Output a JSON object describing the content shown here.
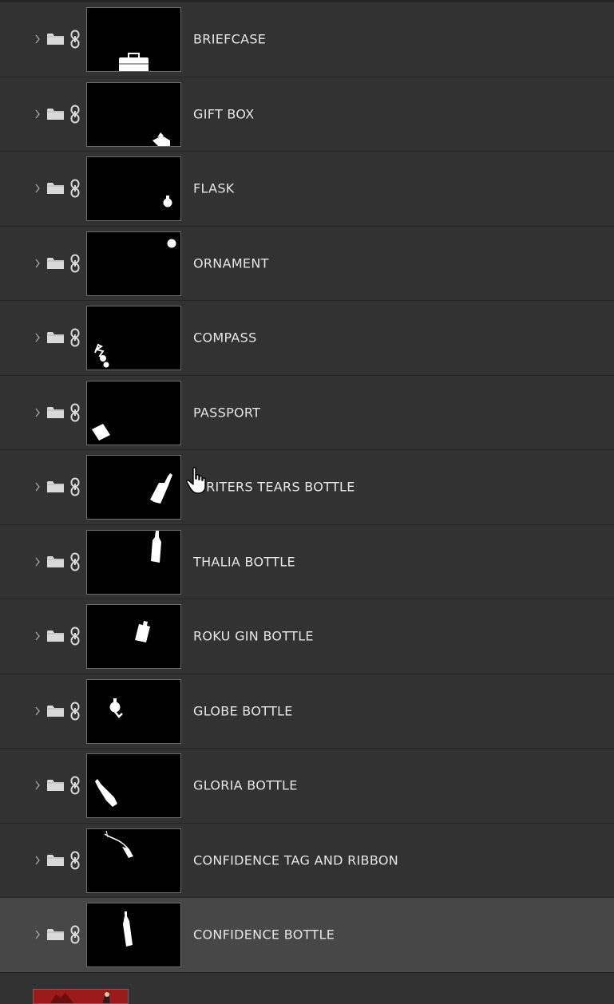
{
  "layers": [
    {
      "name": "BRIEFCASE",
      "mask": "briefcase",
      "selected": false
    },
    {
      "name": "GIFT BOX",
      "mask": "giftbox",
      "selected": false
    },
    {
      "name": "FLASK",
      "mask": "flask",
      "selected": false
    },
    {
      "name": "ORNAMENT",
      "mask": "ornament",
      "selected": false
    },
    {
      "name": "COMPASS",
      "mask": "compass",
      "selected": false
    },
    {
      "name": "PASSPORT",
      "mask": "passport",
      "selected": false
    },
    {
      "name": "WRITERS TEARS BOTTLE",
      "mask": "writers",
      "selected": false
    },
    {
      "name": "THALIA BOTTLE",
      "mask": "thalia",
      "selected": false
    },
    {
      "name": "ROKU GIN BOTTLE",
      "mask": "roku",
      "selected": false
    },
    {
      "name": "GLOBE BOTTLE",
      "mask": "globe",
      "selected": false
    },
    {
      "name": "GLORIA BOTTLE",
      "mask": "gloria",
      "selected": false
    },
    {
      "name": "CONFIDENCE TAG AND RIBBON",
      "mask": "tag",
      "selected": false
    },
    {
      "name": "CONFIDENCE BOTTLE",
      "mask": "confidence",
      "selected": true
    }
  ],
  "icons": {
    "expand": "chevron-right-icon",
    "group": "folder-icon",
    "link": "link-icon",
    "cursor": "hand-pointer-icon"
  },
  "colors": {
    "panel_bg": "#323232",
    "selected_bg": "#474747",
    "text": "#e6e6e6",
    "mask_bg": "#000000",
    "mask_fg": "#ffffff",
    "bottom_thumb": "#9c1a1a"
  }
}
